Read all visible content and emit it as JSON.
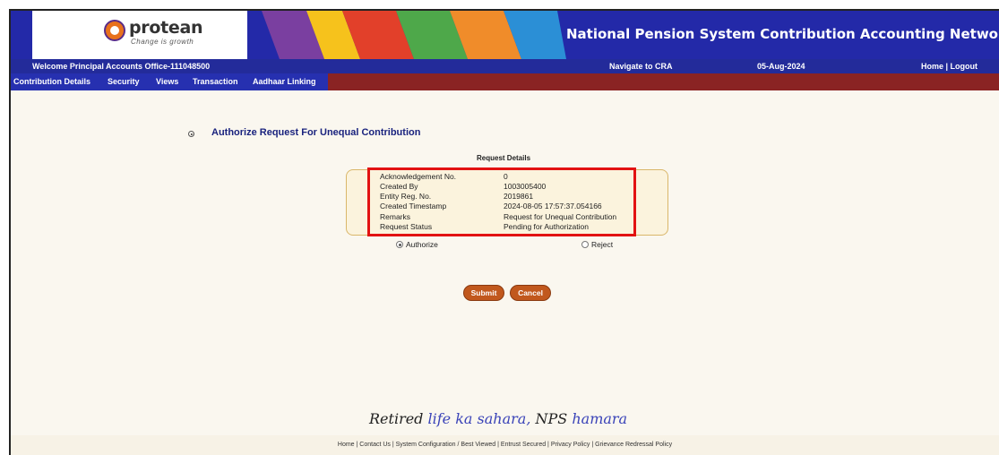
{
  "header": {
    "logo_text": "protean",
    "logo_tagline": "Change is growth",
    "title": "National Pension System Contribution Accounting Network",
    "stripe_colors": [
      "#7a3fa0",
      "#f6c21c",
      "#e2402a",
      "#4ea84a",
      "#f08c2a",
      "#2b8fd6"
    ]
  },
  "welcome_bar": {
    "welcome": "Welcome Principal Accounts Office-111048500",
    "navigate": "Navigate to CRA",
    "date": "05-Aug-2024",
    "home_logout": "Home | Logout"
  },
  "menu": {
    "items": [
      "Contribution Details",
      "Security",
      "Views",
      "Transaction",
      "Aadhaar Linking"
    ]
  },
  "main": {
    "section_title": "Authorize Request For Unequal Contribution",
    "details_heading": "Request Details",
    "rows": [
      {
        "label": "Acknowledgement No.",
        "value": "0"
      },
      {
        "label": "Created By",
        "value": "1003005400"
      },
      {
        "label": "Entity Reg. No.",
        "value": "2019861"
      },
      {
        "label": "Created Timestamp",
        "value": "2024-08-05 17:57:37.054166"
      },
      {
        "label": "Remarks",
        "value": "Request for Unequal Contribution"
      },
      {
        "label": "Request Status",
        "value": "Pending for Authorization"
      }
    ],
    "radio_authorize": "Authorize",
    "radio_reject": "Reject",
    "submit_label": "Submit",
    "cancel_label": "Cancel"
  },
  "slogan": {
    "part1": "Retired",
    "part2": "life ka sahara,",
    "part3": "NPS",
    "part4": "hamara"
  },
  "footer": {
    "links": [
      "Home",
      "Contact Us",
      "System Configuration / Best Viewed",
      "Entrust Secured",
      "Privacy Policy",
      "Grievance Redressal Policy"
    ]
  },
  "colors": {
    "header_bg": "#2329a8",
    "menu_accent": "#8a2323",
    "button": "#c1581d",
    "highlight": "#e21212"
  }
}
